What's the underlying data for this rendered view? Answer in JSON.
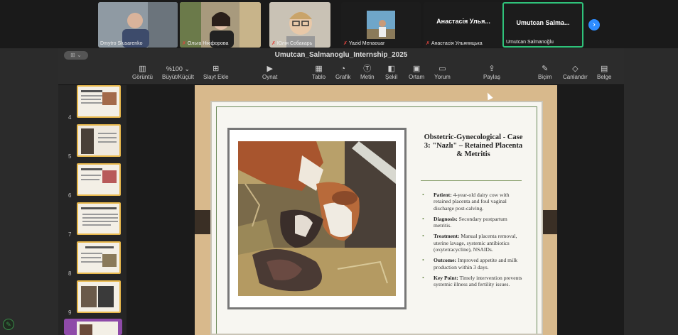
{
  "participants": [
    {
      "name": "Dmytro Slusarenko",
      "muted": false
    },
    {
      "name": "Ольга Нікіфорова",
      "muted": true
    },
    {
      "name": "Юлія Собакарь",
      "muted": true
    },
    {
      "name": "Yazid Menaouar",
      "muted": true
    },
    {
      "name": "Анастасія Ульяницька",
      "muted": true,
      "big_label": "Анастасія Улья..."
    },
    {
      "name": "Umutcan Salmanoğlu",
      "muted": false,
      "big_label": "Umutcan Salma...",
      "active": true
    }
  ],
  "next_icon": "chevron-right-icon",
  "app": {
    "window_button": "⊞ ⌄",
    "document_title": "Umutcan_Salmanoglu_Internship_2025"
  },
  "toolbar": {
    "view": "Görüntü",
    "zoom_value": "%100 ⌄",
    "zoom_label": "Büyüt/Küçült",
    "add_slide": "Slayt Ekle",
    "play": "Oynat",
    "table": "Tablo",
    "chart": "Grafik",
    "text": "Metin",
    "shape": "Şekil",
    "media": "Ortam",
    "comment": "Yorum",
    "share": "Paylaş",
    "format": "Biçim",
    "animate": "Canlandır",
    "document": "Belge"
  },
  "thumbnails": [
    {
      "number": "4"
    },
    {
      "number": "5"
    },
    {
      "number": "6"
    },
    {
      "number": "7"
    },
    {
      "number": "8"
    },
    {
      "number": "9"
    }
  ],
  "slide": {
    "title": "Obstetric-Gynecological - Case 3: \"Nazlı\" – Retained Placenta & Metritis",
    "bullets": [
      {
        "label": "Patient:",
        "text": " 4-year-old dairy cow with retained placenta and foul vaginal discharge post-calving."
      },
      {
        "label": "Diagnosis:",
        "text": " Secondary postpartum metritis."
      },
      {
        "label": "Treatment:",
        "text": " Manual placenta removal, uterine lavage, systemic antibiotics (oxytetracycline), NSAIDs."
      },
      {
        "label": "Outcome:",
        "text": " Improved appetite and milk production within 3 days."
      },
      {
        "label": "Key Point:",
        "text": " Timely intervention prevents systemic illness and fertility issues."
      }
    ]
  }
}
